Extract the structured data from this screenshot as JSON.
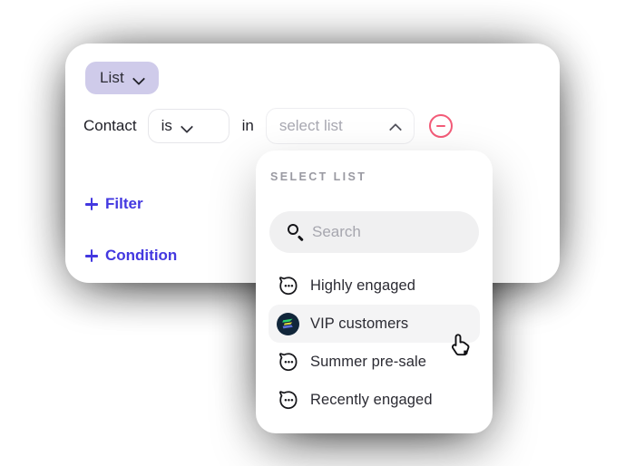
{
  "card": {
    "group_pill": {
      "label": "List",
      "icon": "chevron-down-icon"
    },
    "condition": {
      "subject": "Contact",
      "operator": "is",
      "operator_icon": "chevron-down-icon",
      "joiner": "in",
      "value_placeholder": "select list",
      "value_icon": "chevron-up-icon",
      "remove_icon": "circle-minus-icon"
    },
    "actions": [
      {
        "label": "Filter",
        "icon": "plus-icon"
      },
      {
        "label": "Condition",
        "icon": "plus-icon"
      }
    ]
  },
  "dropdown": {
    "title": "SELECT LIST",
    "search": {
      "placeholder": "Search",
      "value": "",
      "icon": "search-icon"
    },
    "options": [
      {
        "label": "Highly engaged",
        "icon": "chat-face-icon",
        "selected": false
      },
      {
        "label": "VIP customers",
        "icon": "brand-logo-icon",
        "selected": true
      },
      {
        "label": "Summer pre-sale",
        "icon": "chat-face-icon",
        "selected": false
      },
      {
        "label": "Recently engaged",
        "icon": "chat-face-icon",
        "selected": false
      }
    ]
  },
  "cursor": {
    "icon": "pointing-hand-cursor"
  },
  "colors": {
    "pill_bg": "#cfcbea",
    "accent_link": "#4338e0",
    "remove_red": "#f35b78",
    "selected_row_bg": "#f4f4f5",
    "search_bg": "#f0f0f1",
    "brand_navy": "#11263a",
    "brand_green": "#2dd36f",
    "brand_yellow": "#e8dc3c",
    "brand_blue": "#5b6fd8"
  }
}
